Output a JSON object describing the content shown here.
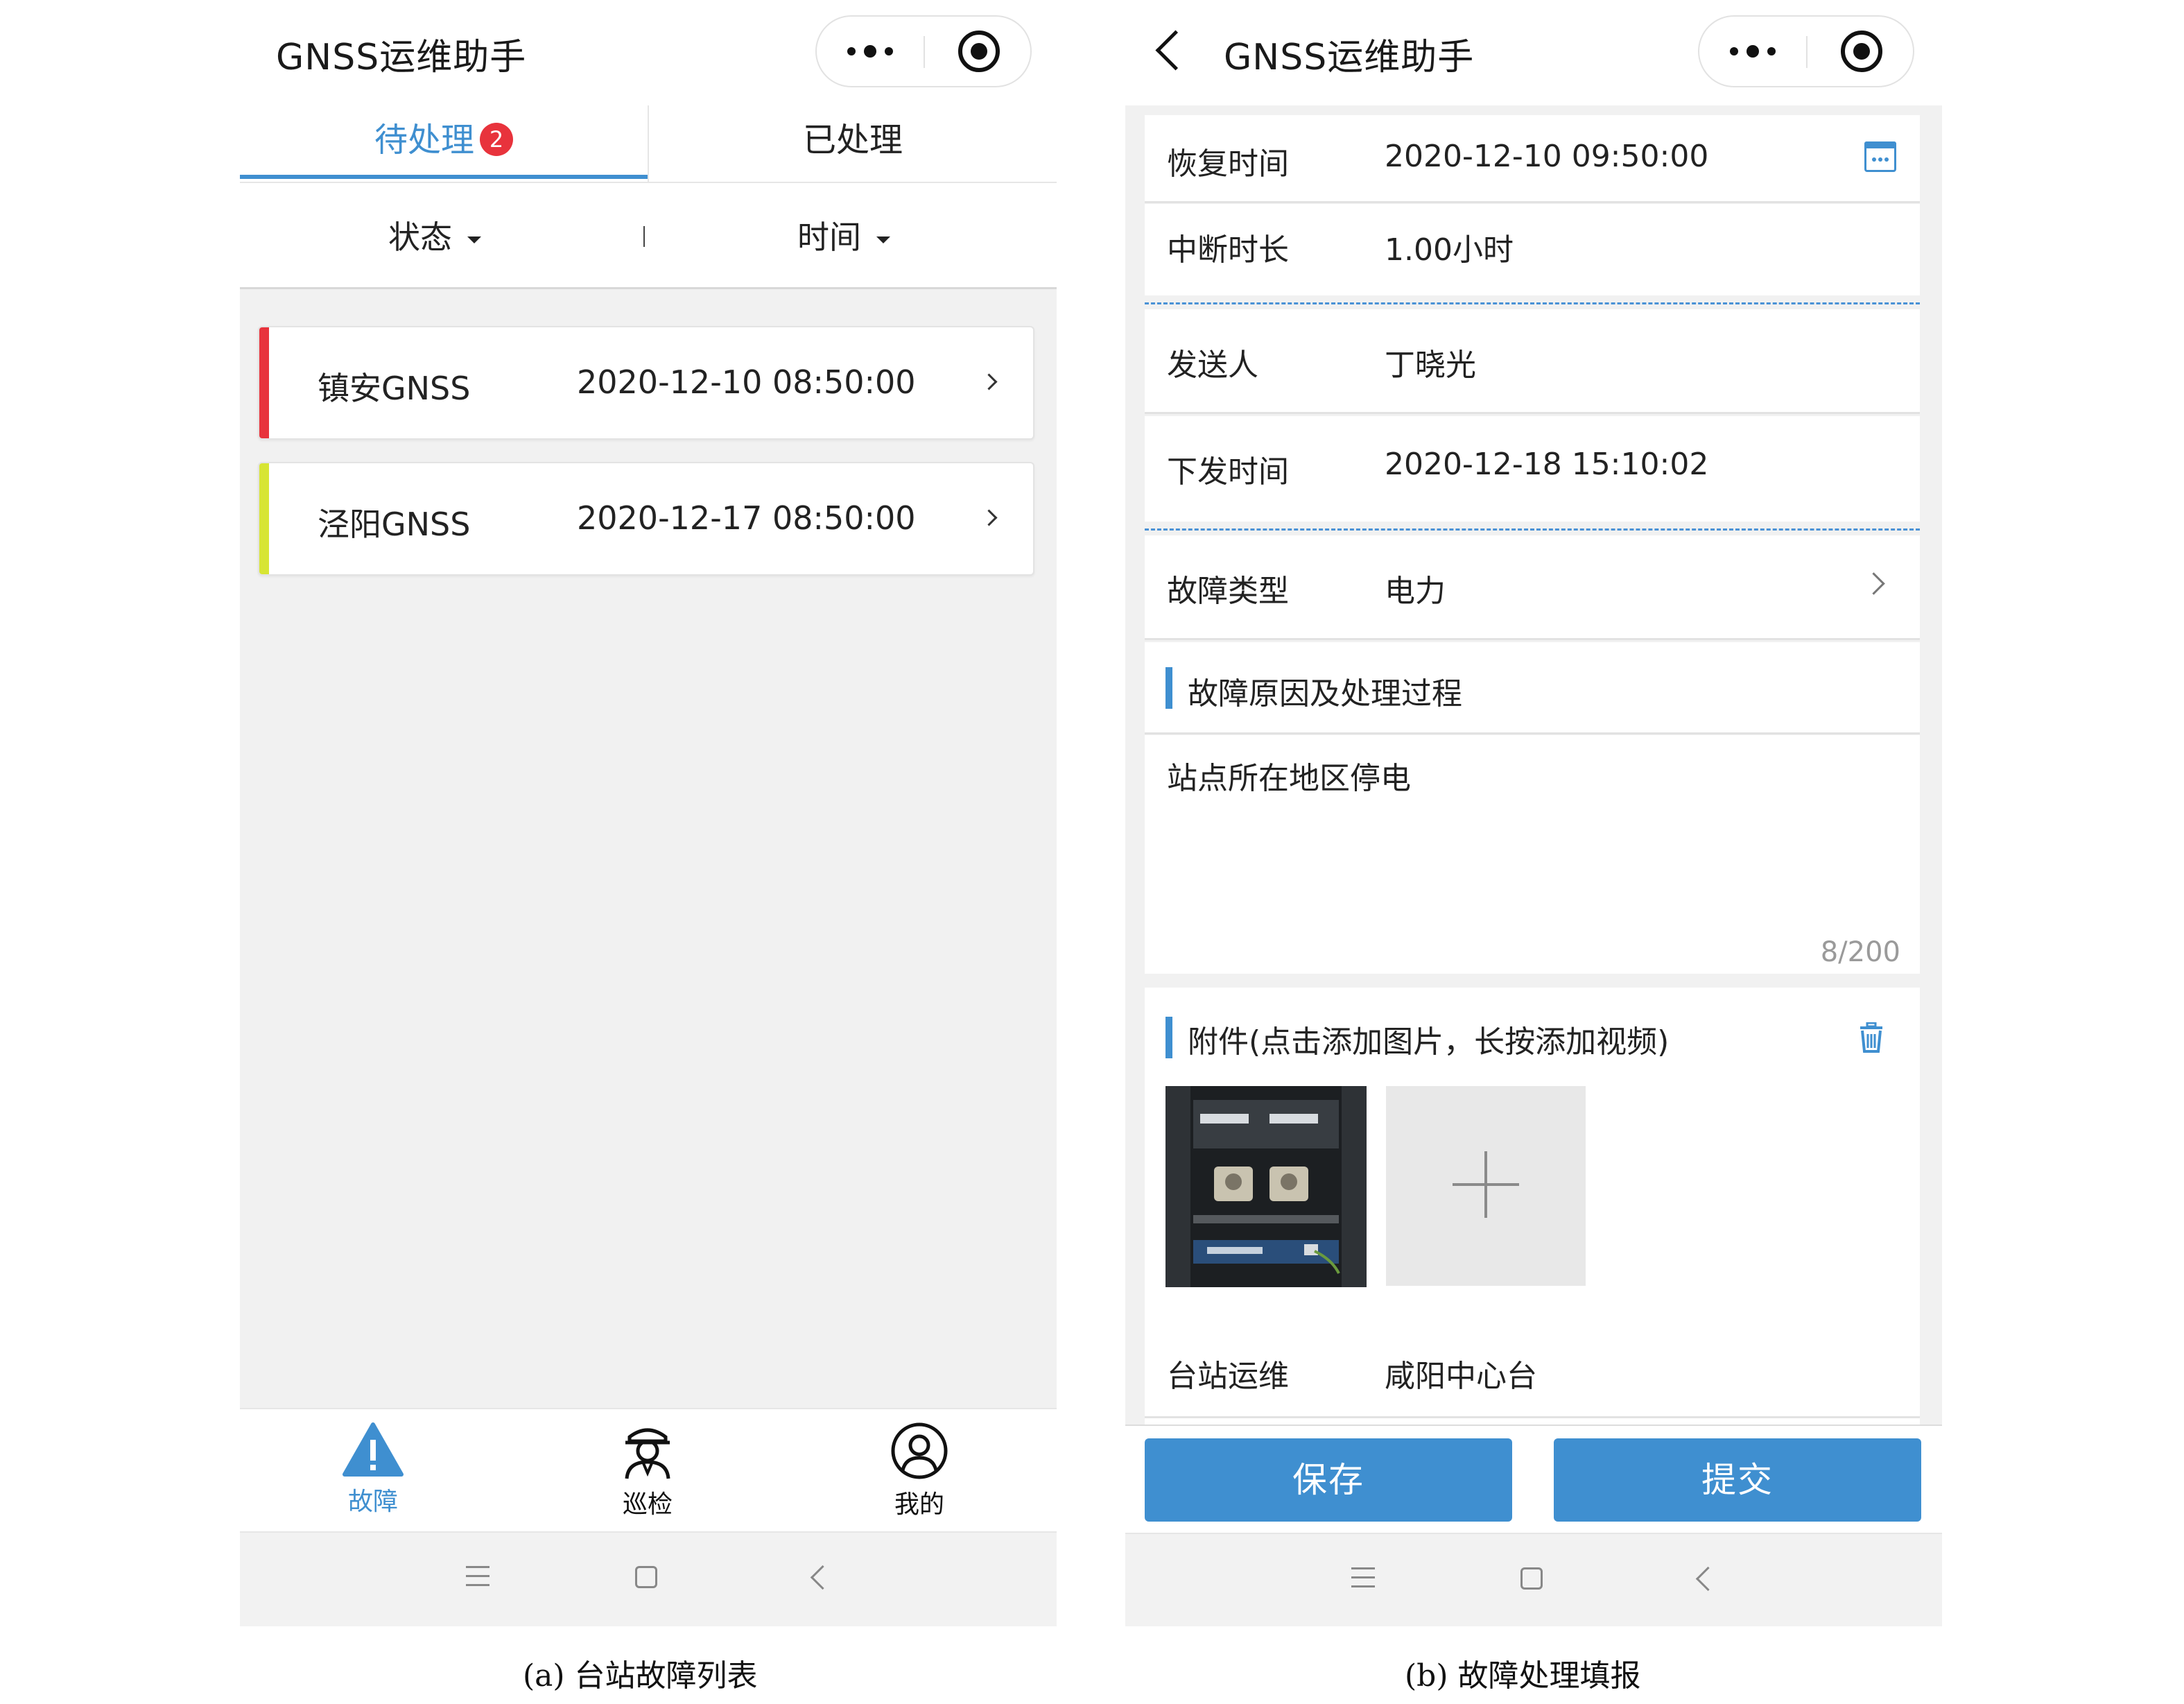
{
  "app_title": "GNSS运维助手",
  "list_screen": {
    "tabs": [
      {
        "label": "待处理",
        "badge": "2"
      },
      {
        "label": "已处理"
      }
    ],
    "filters": [
      {
        "label": "状态"
      },
      {
        "label": "时间"
      }
    ],
    "faults": [
      {
        "station": "镇安GNSS",
        "time": "2020-12-10 08:50:00",
        "status_color": "#e8333c"
      },
      {
        "station": "泾阳GNSS",
        "time": "2020-12-17 08:50:00",
        "status_color": "#d7e534"
      }
    ],
    "bottom_tabs": [
      {
        "label": "故障",
        "icon": "warning-icon",
        "active": true
      },
      {
        "label": "巡检",
        "icon": "inspector-icon",
        "active": false
      },
      {
        "label": "我的",
        "icon": "profile-icon",
        "active": false
      }
    ]
  },
  "form_screen": {
    "fields": {
      "recovery_time": {
        "label": "恢复时间",
        "value": "2020-12-10 09:50:00"
      },
      "interruption": {
        "label": "中断时长",
        "value": "1.00小时"
      },
      "sender": {
        "label": "发送人",
        "value": "丁晓光"
      },
      "issue_time": {
        "label": "下发时间",
        "value": "2020-12-18 15:10:02"
      },
      "fault_type": {
        "label": "故障类型",
        "value": "电力"
      },
      "station_ops": {
        "label": "台站运维",
        "value": "咸阳中心台"
      }
    },
    "cause_section": {
      "title": "故障原因及处理过程",
      "text": "站点所在地区停电",
      "counter": "8/200"
    },
    "attachment_section": {
      "title": "附件(点击添加图片，长按添加视频)"
    },
    "buttons": {
      "save": "保存",
      "submit": "提交"
    }
  },
  "captions": {
    "a": "(a) 台站故障列表",
    "b": "(b) 故障处理填报"
  },
  "colors": {
    "accent": "#3f8fd0",
    "badge": "#e8333c"
  }
}
